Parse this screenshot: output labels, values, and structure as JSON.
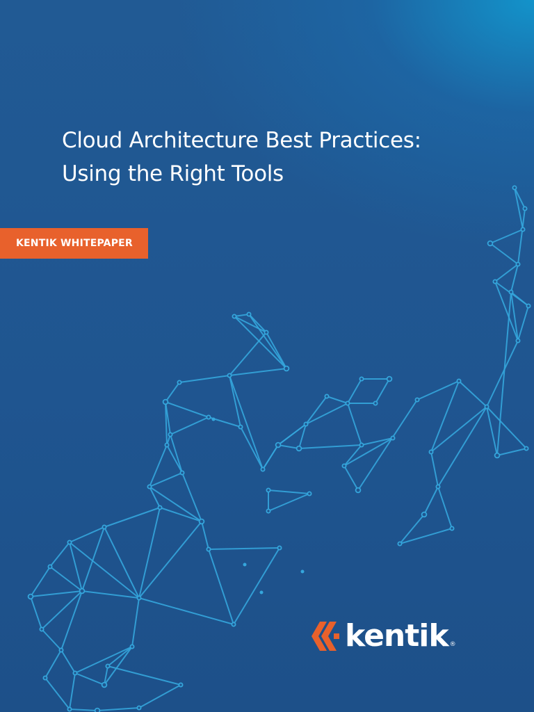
{
  "cover": {
    "title_line1": "Cloud Architecture Best Practices:",
    "title_line2": "Using the Right Tools",
    "badge": "KENTIK WHITEPAPER"
  },
  "brand": {
    "name": "kentik",
    "registered_mark": "®",
    "accent_color": "#e8612c",
    "background_color": "#1f5690",
    "network_color": "#35a6dc"
  },
  "icons": {
    "logo_mark": "kentik-chevron-logo-icon",
    "background": "network-graph-illustration"
  }
}
